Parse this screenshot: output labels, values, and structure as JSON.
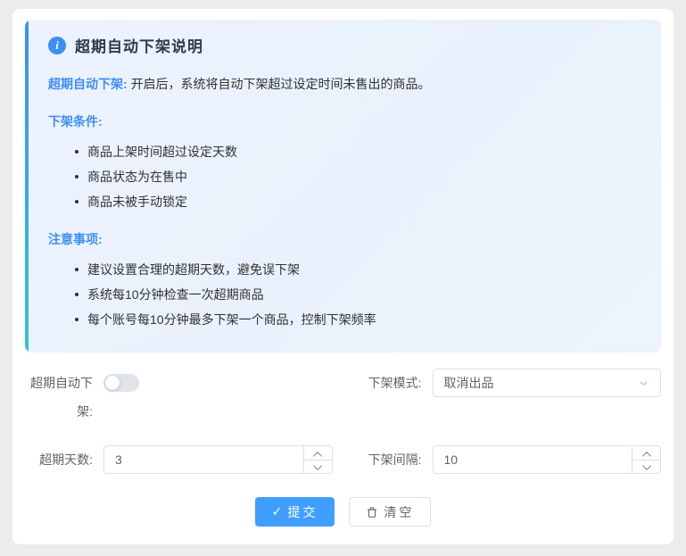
{
  "colors": {
    "accent_blue": "#3e8ef7",
    "accent_teal": "#35c4cc",
    "primary_button": "#409eff",
    "panel_background": "#ebf2fd"
  },
  "info_panel": {
    "icon_glyph": "i",
    "title": "超期自动下架说明",
    "intro_label": "超期自动下架:",
    "intro_text": "开启后，系统将自动下架超过设定时间未售出的商品。",
    "sections": [
      {
        "heading": "下架条件:",
        "items": [
          "商品上架时间超过设定天数",
          "商品状态为在售中",
          "商品未被手动锁定"
        ]
      },
      {
        "heading": "注意事项:",
        "items": [
          "建议设置合理的超期天数，避免误下架",
          "系统每10分钟检查一次超期商品",
          "每个账号每10分钟最多下架一个商品，控制下架频率"
        ]
      }
    ]
  },
  "form": {
    "auto_delist": {
      "label": "超期自动下架:",
      "state": "off"
    },
    "mode": {
      "label": "下架模式:",
      "value": "取消出品"
    },
    "days": {
      "label": "超期天数:",
      "value": "3"
    },
    "interval": {
      "label": "下架间隔:",
      "value": "10"
    },
    "submit_label": "提交",
    "submit_icon_glyph": "✓",
    "clear_label": "清空"
  }
}
